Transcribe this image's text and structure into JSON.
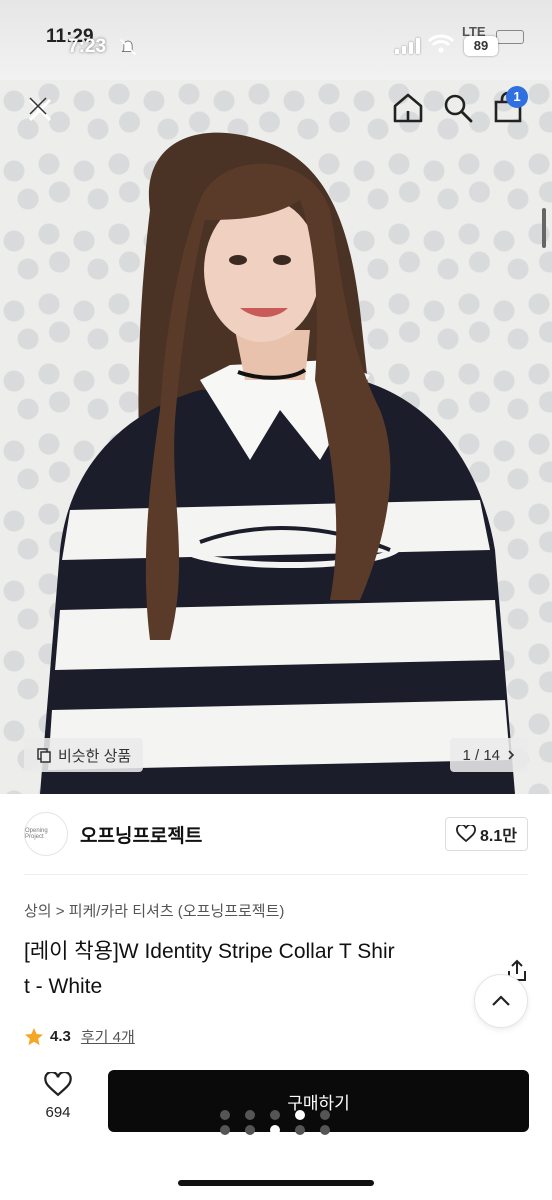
{
  "status_bar": {
    "time_back": "11:29",
    "time_front": "7:23",
    "network": "LTE",
    "battery": "89"
  },
  "header": {
    "cart_count": "1",
    "icons": [
      "close-icon",
      "home-icon",
      "search-icon",
      "shopping-bag-icon"
    ]
  },
  "gallery": {
    "similar_label": "비슷한 상품",
    "page_indicator": "1 / 14"
  },
  "brand": {
    "logo_text": "Opening Project",
    "name": "오프닝프로젝트",
    "likes": "8.1만"
  },
  "product": {
    "breadcrumb": "상의 > 피케/카라 티셔츠 (오프닝프로젝트)",
    "title_line1": "[레이 착용]W Identity Stripe Collar T Shir",
    "title_line2": "t - White",
    "rating": "4.3",
    "reviews": "후기 4개"
  },
  "actions": {
    "wish_count": "694",
    "buy_label": "구매하기"
  },
  "colors": {
    "accent_badge": "#2f6fe0",
    "buy_button": "#0a0a0a",
    "star": "#f5a623"
  }
}
